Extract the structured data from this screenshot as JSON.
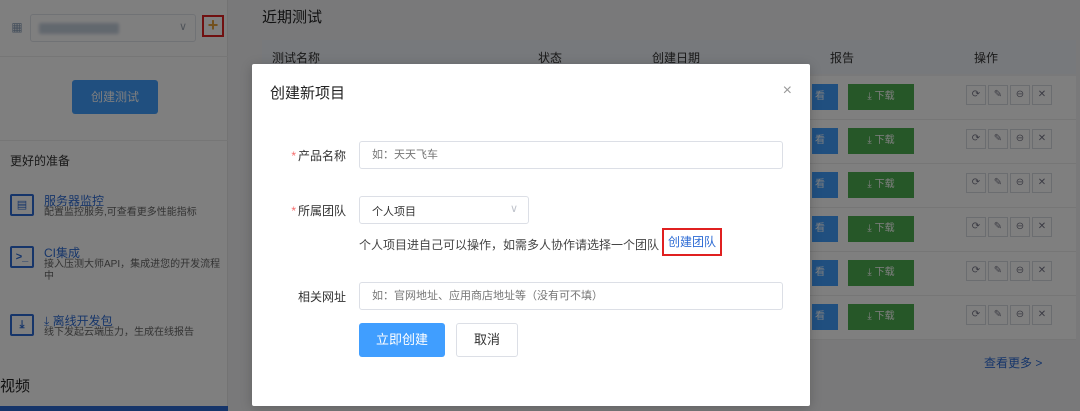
{
  "sidebar": {
    "add_label": "+",
    "create_test_label": "创建测试",
    "prep_title": "更好的准备",
    "features": [
      {
        "icon": "server-monitor-icon",
        "glyph": "▤",
        "title": "服务器监控",
        "desc": "配置监控服务,可查看更多性能指标"
      },
      {
        "icon": "terminal-icon",
        "glyph": ">_",
        "title": "CI集成",
        "desc": "接入压测大师API，集成进您的开发流程中"
      },
      {
        "icon": "download-box-icon",
        "glyph": "⤓",
        "title": "⤓ 离线开发包",
        "desc": "线下发起云端压力，生成在线报告"
      }
    ],
    "video_title": "视频"
  },
  "main": {
    "recent_title": "近期测试",
    "headers": {
      "name": "测试名称",
      "status": "状态",
      "date": "创建日期",
      "report": "报告",
      "ops": "操作"
    },
    "row_view_label": "看",
    "row_download_label": "⤓ 下载",
    "op_icons": [
      "⟳",
      "✎",
      "⊖",
      "✕"
    ],
    "see_more": "查看更多 >"
  },
  "modal": {
    "title": "创建新项目",
    "close": "×",
    "product_label": "产品名称",
    "product_placeholder": "如：天天飞车",
    "team_label": "所属团队",
    "team_value": "个人项目",
    "team_hint": "个人项目进自己可以操作，如需多人协作请选择一个团队",
    "create_team": "创建团队",
    "url_label": "相关网址",
    "url_placeholder": "如：官网地址、应用商店地址等（没有可不填）",
    "submit": "立即创建",
    "cancel": "取消"
  }
}
